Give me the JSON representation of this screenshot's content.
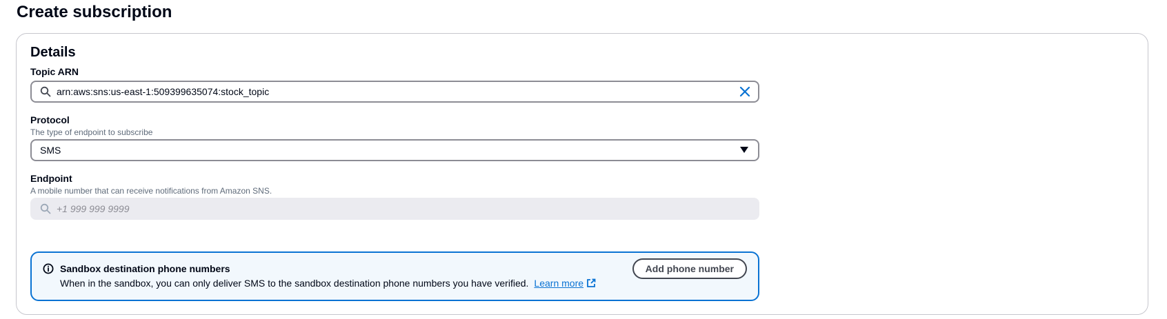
{
  "page": {
    "title": "Create subscription"
  },
  "details": {
    "title": "Details",
    "topic_arn": {
      "label": "Topic ARN",
      "value": "arn:aws:sns:us-east-1:509399635074:stock_topic"
    },
    "protocol": {
      "label": "Protocol",
      "description": "The type of endpoint to subscribe",
      "selected": "SMS"
    },
    "endpoint": {
      "label": "Endpoint",
      "description": "A mobile number that can receive notifications from Amazon SNS.",
      "placeholder": "+1 999 999 9999"
    },
    "alert": {
      "title": "Sandbox destination phone numbers",
      "body": "When in the sandbox, you can only deliver SMS to the sandbox destination phone numbers you have verified.",
      "link_label": "Learn more",
      "button_label": "Add phone number"
    }
  },
  "colors": {
    "accent": "#0972d3",
    "alert_background": "#f2f8fd",
    "text": "#000716",
    "muted": "#5f6b7a"
  },
  "icons": {
    "topic_search": "search-icon",
    "topic_clear": "close-icon",
    "protocol_caret": "caret-down-icon",
    "endpoint_search": "search-icon",
    "alert_info": "info-icon",
    "link_external": "external-link-icon"
  }
}
